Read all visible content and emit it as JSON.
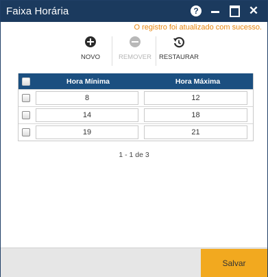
{
  "window": {
    "title": "Faixa Horária",
    "help_glyph": "?",
    "close_glyph": "✕"
  },
  "status": {
    "message": "O registro foi atualizado com sucesso.",
    "color": "#e8860e"
  },
  "toolbar": {
    "novo_label": "NOVO",
    "remover_label": "REMOVER",
    "restaurar_label": "RESTAURAR",
    "novo_icon": "plus-circle-icon",
    "remover_icon": "minus-circle-icon",
    "restaurar_icon": "history-icon"
  },
  "grid": {
    "columns": [
      "Hora Mínima",
      "Hora Máxima"
    ],
    "rows": [
      {
        "min": "8",
        "max": "12"
      },
      {
        "min": "14",
        "max": "18"
      },
      {
        "min": "19",
        "max": "21"
      }
    ],
    "header_color": "#1b4f80"
  },
  "pager": {
    "text": "1 - 1 de 3"
  },
  "footer": {
    "save_label": "Salvar",
    "save_color": "#f2a91f"
  }
}
